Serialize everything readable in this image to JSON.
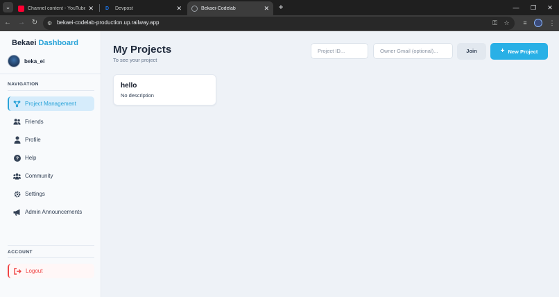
{
  "browser": {
    "tabs": [
      {
        "title": "Channel content - YouTube Studio",
        "favicon_color": "#ff0033",
        "icon": "youtube-icon",
        "active": false
      },
      {
        "title": "Devpost",
        "favicon_color": "#1a73e8",
        "icon": "devpost-icon",
        "favicon_letter": "D",
        "active": false
      },
      {
        "title": "Bekaei-Codelab",
        "favicon_color": "#9aa0a6",
        "icon": "globe-icon",
        "active": true
      }
    ],
    "url": "bekaei-codelab-production.up.railway.app"
  },
  "sidebar": {
    "brand_main": "Bekaei",
    "brand_accent": "Dashboard",
    "username": "beka_ei",
    "navigation_label": "NAVIGATION",
    "items": [
      {
        "label": "Project Management",
        "icon": "project-network-icon",
        "active": true
      },
      {
        "label": "Friends",
        "icon": "friends-icon",
        "active": false
      },
      {
        "label": "Profile",
        "icon": "profile-icon",
        "active": false
      },
      {
        "label": "Help",
        "icon": "help-icon",
        "active": false
      },
      {
        "label": "Community",
        "icon": "community-icon",
        "active": false
      },
      {
        "label": "Settings",
        "icon": "gear-icon",
        "active": false
      },
      {
        "label": "Admin Announcements",
        "icon": "megaphone-icon",
        "active": false
      }
    ],
    "account_label": "ACCOUNT",
    "logout_label": "Logout"
  },
  "main": {
    "title": "My Projects",
    "subtitle": "To see your project",
    "project_id_placeholder": "Project ID...",
    "owner_gmail_placeholder": "Owner Gmail (optional)...",
    "join_label": "Join",
    "new_project_label": "New Project",
    "projects": [
      {
        "name": "hello",
        "description": "No description"
      }
    ]
  },
  "colors": {
    "accent": "#29a3d8",
    "button_primary": "#29b0e6",
    "danger": "#ef4444"
  }
}
